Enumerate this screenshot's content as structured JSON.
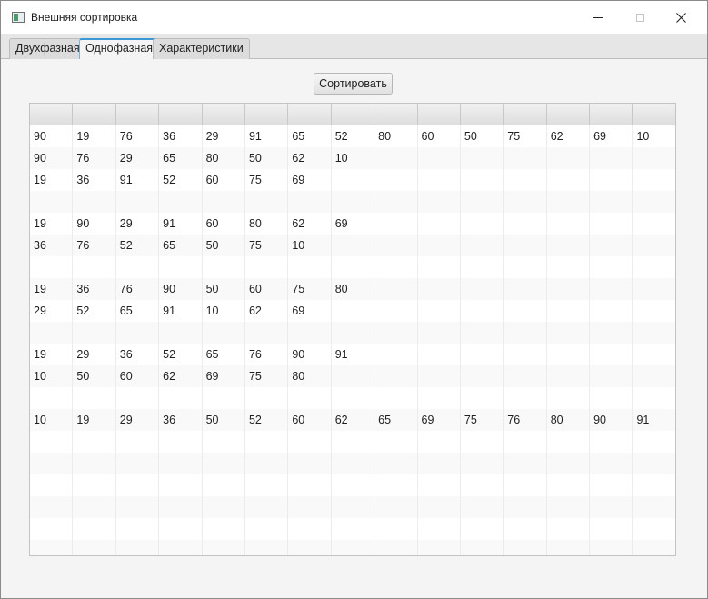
{
  "window": {
    "title": "Внешняя сортировка"
  },
  "tabs": [
    {
      "label": "Двухфазная",
      "selected": false
    },
    {
      "label": "Однофазная",
      "selected": true
    },
    {
      "label": "Характеристики",
      "selected": false
    }
  ],
  "sort_button_label": "Сортировать",
  "table": {
    "column_count": 15,
    "headers": [
      "",
      "",
      "",
      "",
      "",
      "",
      "",
      "",
      "",
      "",
      "",
      "",
      "",
      "",
      ""
    ],
    "rows": [
      [
        "90",
        "19",
        "76",
        "36",
        "29",
        "91",
        "65",
        "52",
        "80",
        "60",
        "50",
        "75",
        "62",
        "69",
        "10"
      ],
      [
        "90",
        "76",
        "29",
        "65",
        "80",
        "50",
        "62",
        "10",
        "",
        "",
        "",
        "",
        "",
        "",
        ""
      ],
      [
        "19",
        "36",
        "91",
        "52",
        "60",
        "75",
        "69",
        "",
        "",
        "",
        "",
        "",
        "",
        "",
        ""
      ],
      [
        "",
        "",
        "",
        "",
        "",
        "",
        "",
        "",
        "",
        "",
        "",
        "",
        "",
        "",
        ""
      ],
      [
        "19",
        "90",
        "29",
        "91",
        "60",
        "80",
        "62",
        "69",
        "",
        "",
        "",
        "",
        "",
        "",
        ""
      ],
      [
        "36",
        "76",
        "52",
        "65",
        "50",
        "75",
        "10",
        "",
        "",
        "",
        "",
        "",
        "",
        "",
        ""
      ],
      [
        "",
        "",
        "",
        "",
        "",
        "",
        "",
        "",
        "",
        "",
        "",
        "",
        "",
        "",
        ""
      ],
      [
        "19",
        "36",
        "76",
        "90",
        "50",
        "60",
        "75",
        "80",
        "",
        "",
        "",
        "",
        "",
        "",
        ""
      ],
      [
        "29",
        "52",
        "65",
        "91",
        "10",
        "62",
        "69",
        "",
        "",
        "",
        "",
        "",
        "",
        "",
        ""
      ],
      [
        "",
        "",
        "",
        "",
        "",
        "",
        "",
        "",
        "",
        "",
        "",
        "",
        "",
        "",
        ""
      ],
      [
        "19",
        "29",
        "36",
        "52",
        "65",
        "76",
        "90",
        "91",
        "",
        "",
        "",
        "",
        "",
        "",
        ""
      ],
      [
        "10",
        "50",
        "60",
        "62",
        "69",
        "75",
        "80",
        "",
        "",
        "",
        "",
        "",
        "",
        "",
        ""
      ],
      [
        "",
        "",
        "",
        "",
        "",
        "",
        "",
        "",
        "",
        "",
        "",
        "",
        "",
        "",
        ""
      ],
      [
        "10",
        "19",
        "29",
        "36",
        "50",
        "52",
        "60",
        "62",
        "65",
        "69",
        "75",
        "76",
        "80",
        "90",
        "91"
      ],
      [
        "",
        "",
        "",
        "",
        "",
        "",
        "",
        "",
        "",
        "",
        "",
        "",
        "",
        "",
        ""
      ],
      [
        "",
        "",
        "",
        "",
        "",
        "",
        "",
        "",
        "",
        "",
        "",
        "",
        "",
        "",
        ""
      ],
      [
        "",
        "",
        "",
        "",
        "",
        "",
        "",
        "",
        "",
        "",
        "",
        "",
        "",
        "",
        ""
      ],
      [
        "",
        "",
        "",
        "",
        "",
        "",
        "",
        "",
        "",
        "",
        "",
        "",
        "",
        "",
        ""
      ],
      [
        "",
        "",
        "",
        "",
        "",
        "",
        "",
        "",
        "",
        "",
        "",
        "",
        "",
        "",
        ""
      ],
      [
        "",
        "",
        "",
        "",
        "",
        "",
        "",
        "",
        "",
        "",
        "",
        "",
        "",
        "",
        ""
      ]
    ]
  },
  "icons": {
    "app": "app-window-icon",
    "minimize": "minimize-icon",
    "maximize": "maximize-icon",
    "close": "close-icon"
  },
  "colors": {
    "accent": "#3a98d6"
  }
}
